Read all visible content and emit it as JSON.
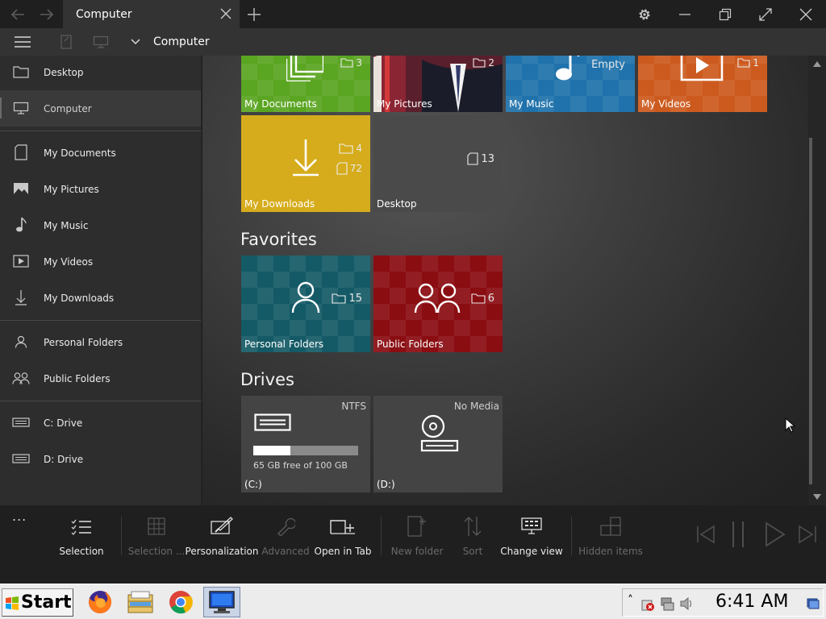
{
  "titlebar": {
    "tab_title": "Computer"
  },
  "addressbar": {
    "path": "Computer"
  },
  "sidebar": {
    "items": [
      {
        "label": "Desktop",
        "icon": "folder-icon"
      },
      {
        "label": "Computer",
        "icon": "monitor-icon",
        "selected": true
      },
      {
        "label": "My Documents",
        "icon": "document-icon"
      },
      {
        "label": "My Pictures",
        "icon": "picture-icon"
      },
      {
        "label": "My Music",
        "icon": "music-note-icon"
      },
      {
        "label": "My Videos",
        "icon": "video-icon"
      },
      {
        "label": "My Downloads",
        "icon": "download-icon"
      },
      {
        "label": "Personal Folders",
        "icon": "person-icon"
      },
      {
        "label": "Public Folders",
        "icon": "people-icon"
      },
      {
        "label": "C:  Drive",
        "icon": "drive-icon"
      },
      {
        "label": "D:  Drive",
        "icon": "drive-icon"
      }
    ]
  },
  "libraries": [
    {
      "label": "My Documents",
      "count": "3",
      "color": "#5aa521"
    },
    {
      "label": "My Pictures",
      "count": "2",
      "color": "#7a2a35"
    },
    {
      "label": "My Music",
      "count": "Empty",
      "color": "#1f72ab"
    },
    {
      "label": "My Videos",
      "count": "1",
      "color": "#cc5a1e"
    },
    {
      "label": "My Downloads",
      "folders": "4",
      "files": "72",
      "color": "#d6ac1c"
    },
    {
      "label": "Desktop",
      "files": "13",
      "color": "#4a4a4a"
    }
  ],
  "favorites": {
    "title": "Favorites",
    "tiles": [
      {
        "label": "Personal Folders",
        "count": "15",
        "color": "#145a66"
      },
      {
        "label": "Public Folders",
        "count": "6",
        "color": "#8a0d12"
      }
    ]
  },
  "drives": {
    "title": "Drives",
    "tiles": [
      {
        "label": "(C:)",
        "fs": "NTFS",
        "free": "65 GB free of 100 GB",
        "used_fraction": 0.35
      },
      {
        "label": "(D:)",
        "fs": "No Media"
      }
    ]
  },
  "ribbon": {
    "more": "...",
    "items": [
      {
        "label": "Selection",
        "enabled": true
      },
      {
        "label": "Selection ...",
        "enabled": false
      },
      {
        "label": "Personalization",
        "enabled": true
      },
      {
        "label": "Advanced",
        "enabled": false
      },
      {
        "label": "Open in Tab",
        "enabled": true
      },
      {
        "label": "New folder",
        "enabled": false
      },
      {
        "label": "Sort",
        "enabled": false
      },
      {
        "label": "Change view",
        "enabled": true
      },
      {
        "label": "Hidden items",
        "enabled": false
      }
    ]
  },
  "taskbar": {
    "start_label": "Start",
    "clock": "6:41 AM",
    "tray_arrow": "˄"
  },
  "colors": {
    "accent": "#3a3a3a"
  }
}
